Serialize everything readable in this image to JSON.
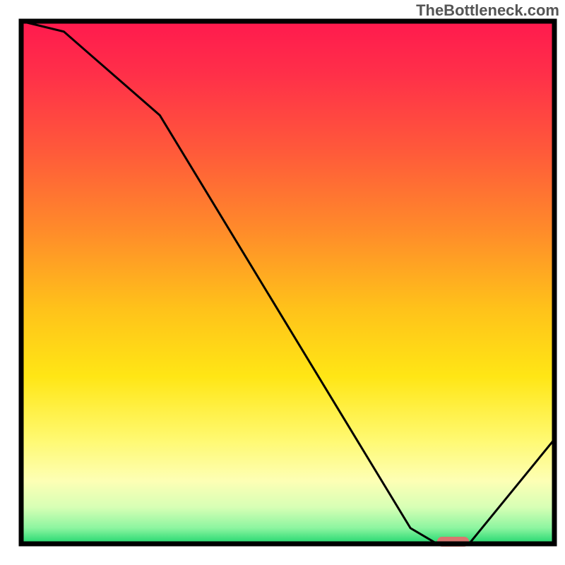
{
  "watermark": "TheBottleneck.com",
  "chart_data": {
    "type": "line",
    "title": "",
    "xlabel": "",
    "ylabel": "",
    "xlim": [
      0,
      100
    ],
    "ylim": [
      0,
      100
    ],
    "curve": {
      "name": "bottleneck-curve",
      "x": [
        0,
        8,
        26,
        73,
        78,
        84,
        100
      ],
      "y": [
        100,
        98,
        82,
        3,
        0,
        0,
        20
      ]
    },
    "optimum_band": {
      "x_start": 78,
      "x_end": 84,
      "y": 0
    },
    "gradient_stops": [
      {
        "offset": 0.0,
        "color": "#ff1a4e"
      },
      {
        "offset": 0.1,
        "color": "#ff2f49"
      },
      {
        "offset": 0.25,
        "color": "#ff5a3a"
      },
      {
        "offset": 0.4,
        "color": "#ff8b2a"
      },
      {
        "offset": 0.55,
        "color": "#ffc21a"
      },
      {
        "offset": 0.68,
        "color": "#ffe615"
      },
      {
        "offset": 0.8,
        "color": "#fff970"
      },
      {
        "offset": 0.88,
        "color": "#fdffb5"
      },
      {
        "offset": 0.93,
        "color": "#d7ffb5"
      },
      {
        "offset": 0.97,
        "color": "#8cf5a0"
      },
      {
        "offset": 1.0,
        "color": "#1fd66e"
      }
    ],
    "colors": {
      "frame": "#000000",
      "curve": "#000000",
      "optimum": "#d9766f"
    }
  }
}
